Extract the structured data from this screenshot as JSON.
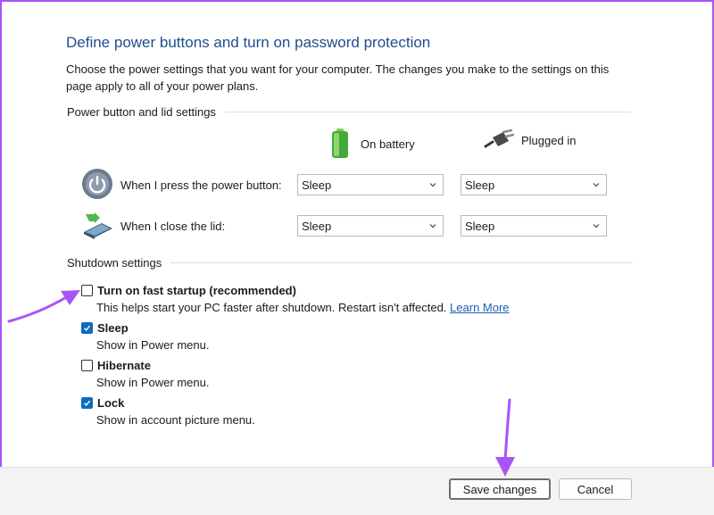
{
  "title": "Define power buttons and turn on password protection",
  "description": "Choose the power settings that you want for your computer. The changes you make to the settings on this page apply to all of your power plans.",
  "power_section": {
    "heading": "Power button and lid settings",
    "columns": {
      "battery": "On battery",
      "plugged": "Plugged in"
    },
    "rows": [
      {
        "label": "When I press the power button:",
        "battery": "Sleep",
        "plugged": "Sleep"
      },
      {
        "label": "When I close the lid:",
        "battery": "Sleep",
        "plugged": "Sleep"
      }
    ]
  },
  "shutdown_section": {
    "heading": "Shutdown settings",
    "items": [
      {
        "label": "Turn on fast startup (recommended)",
        "checked": false,
        "desc": "This helps start your PC faster after shutdown. Restart isn't affected.",
        "link": "Learn More"
      },
      {
        "label": "Sleep",
        "checked": true,
        "desc": "Show in Power menu."
      },
      {
        "label": "Hibernate",
        "checked": false,
        "desc": "Show in Power menu."
      },
      {
        "label": "Lock",
        "checked": true,
        "desc": "Show in account picture menu."
      }
    ]
  },
  "footer": {
    "save_label": "Save changes",
    "cancel_label": "Cancel"
  },
  "colors": {
    "title": "#1e4e8c",
    "accent": "#0f6cbd",
    "annotation_arrow": "#a855f7"
  },
  "icons": [
    "battery-icon",
    "plug-icon",
    "power-button-icon",
    "laptop-lid-icon",
    "chevron-down-icon",
    "checkmark-icon",
    "annotation-arrow-icon"
  ]
}
